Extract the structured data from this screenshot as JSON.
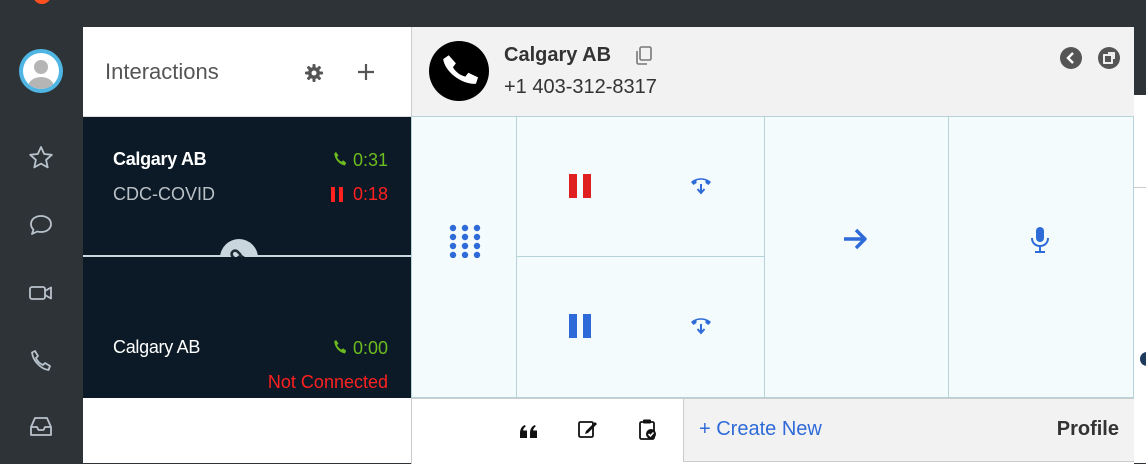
{
  "sidebar": {
    "icons": [
      "avatar",
      "star-icon",
      "chat-icon",
      "video-icon",
      "phone-icon",
      "inbox-icon"
    ]
  },
  "interactions": {
    "title": "Interactions",
    "cards": [
      {
        "name": "Calgary AB",
        "queue": "CDC-COVID",
        "talk_time": "0:31",
        "hold_time": "0:18"
      },
      {
        "name": "Calgary AB",
        "talk_time": "0:00",
        "status": "Not Connected"
      }
    ]
  },
  "call": {
    "name": "Calgary AB",
    "number": "+1 403-312-8317"
  },
  "controls": [
    "dialpad-icon",
    "hold-icon",
    "transfer-icon",
    "hold-icon",
    "transfer-icon",
    "forward-icon",
    "mic-icon"
  ],
  "toolbar": {
    "create_new": "+ Create New",
    "profile": "Profile"
  },
  "colors": {
    "accent_blue": "#2f6bd8",
    "talk_green": "#6dbb1e",
    "hold_red": "#ff2020",
    "card_bg": "#0b1a26",
    "sidebar_bg": "#2e3338"
  }
}
